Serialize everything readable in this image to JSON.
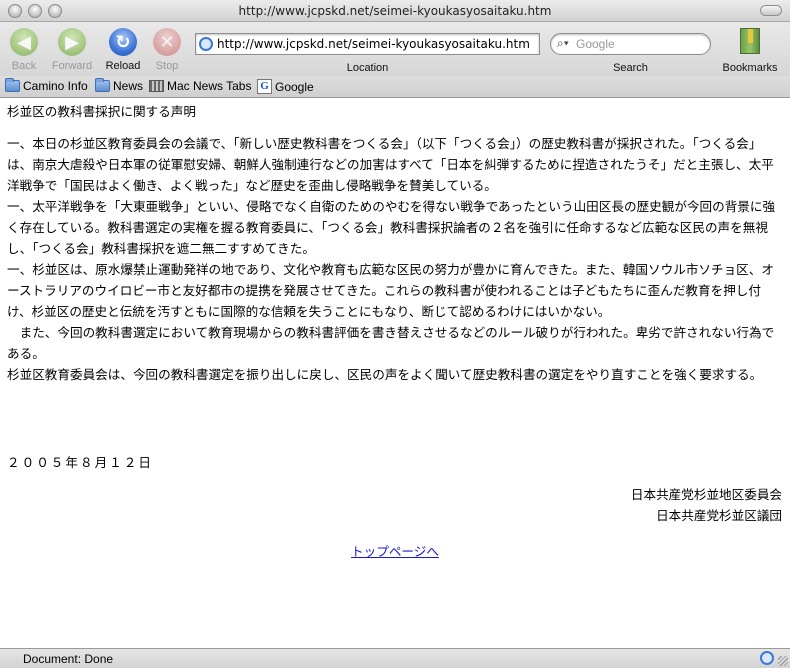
{
  "window": {
    "title": "http://www.jcpskd.net/seimei-kyoukasyosaitaku.htm"
  },
  "toolbar": {
    "back_label": "Back",
    "forward_label": "Forward",
    "reload_label": "Reload",
    "stop_label": "Stop",
    "url_value": "http://www.jcpskd.net/seimei-kyoukasyosaitaku.htm",
    "location_label": "Location",
    "search_placeholder": "Google",
    "search_label": "Search",
    "bookmarks_label": "Bookmarks"
  },
  "personal_toolbar": {
    "items": [
      {
        "label": "Camino Info",
        "icon": "folder-icon"
      },
      {
        "label": "News",
        "icon": "folder-icon"
      },
      {
        "label": "Mac News Tabs",
        "icon": "tabs-icon"
      },
      {
        "label": "Google",
        "icon": "google-icon"
      }
    ]
  },
  "page": {
    "title": "杉並区の教科書採択に関する声明",
    "paragraphs": [
      "一、本日の杉並区教育委員会の会議で、「新しい歴史教科書をつくる会」（以下「つくる会」）の歴史教科書が採択された。「つくる会」は、南京大虐殺や日本軍の従軍慰安婦、朝鮮人強制連行などの加害はすべて「日本を糾弾するために捏造されたうそ」だと主張し、太平洋戦争で「国民はよく働き、よく戦った」など歴史を歪曲し侵略戦争を賛美している。",
      "一、太平洋戦争を「大東亜戦争」といい、侵略でなく自衛のためのやむを得ない戦争であったという山田区長の歴史観が今回の背景に強く存在している。教科書選定の実権を握る教育委員に、「つくる会」教科書採択論者の２名を強引に任命するなど広範な区民の声を無視し、「つくる会」教科書採択を遮二無二すすめてきた。",
      "一、杉並区は、原水爆禁止運動発祥の地であり、文化や教育も広範な区民の努力が豊かに育んできた。また、韓国ソウル市ソチョ区、オーストラリアのウイロビー市と友好都市の提携を発展させてきた。これらの教科書が使われることは子どもたちに歪んだ教育を押し付け、杉並区の歴史と伝統を汚すともに国際的な信頼を失うことにもなり、断じて認めるわけにはいかない。",
      "　また、今回の教科書選定において教育現場からの教科書評価を書き替えさせるなどのルール破りが行われた。卑劣で許されない行為である。",
      "杉並区教育委員会は、今回の教科書選定を振り出しに戻し、区民の声をよく聞いて歴史教科書の選定をやり直すことを強く要求する。"
    ],
    "date": "２００５年８月１２日",
    "signature_1": "日本共産党杉並地区委員会",
    "signature_2": "日本共産党杉並区議団",
    "top_link": "トップページへ"
  },
  "status": {
    "text": "Document: Done"
  }
}
